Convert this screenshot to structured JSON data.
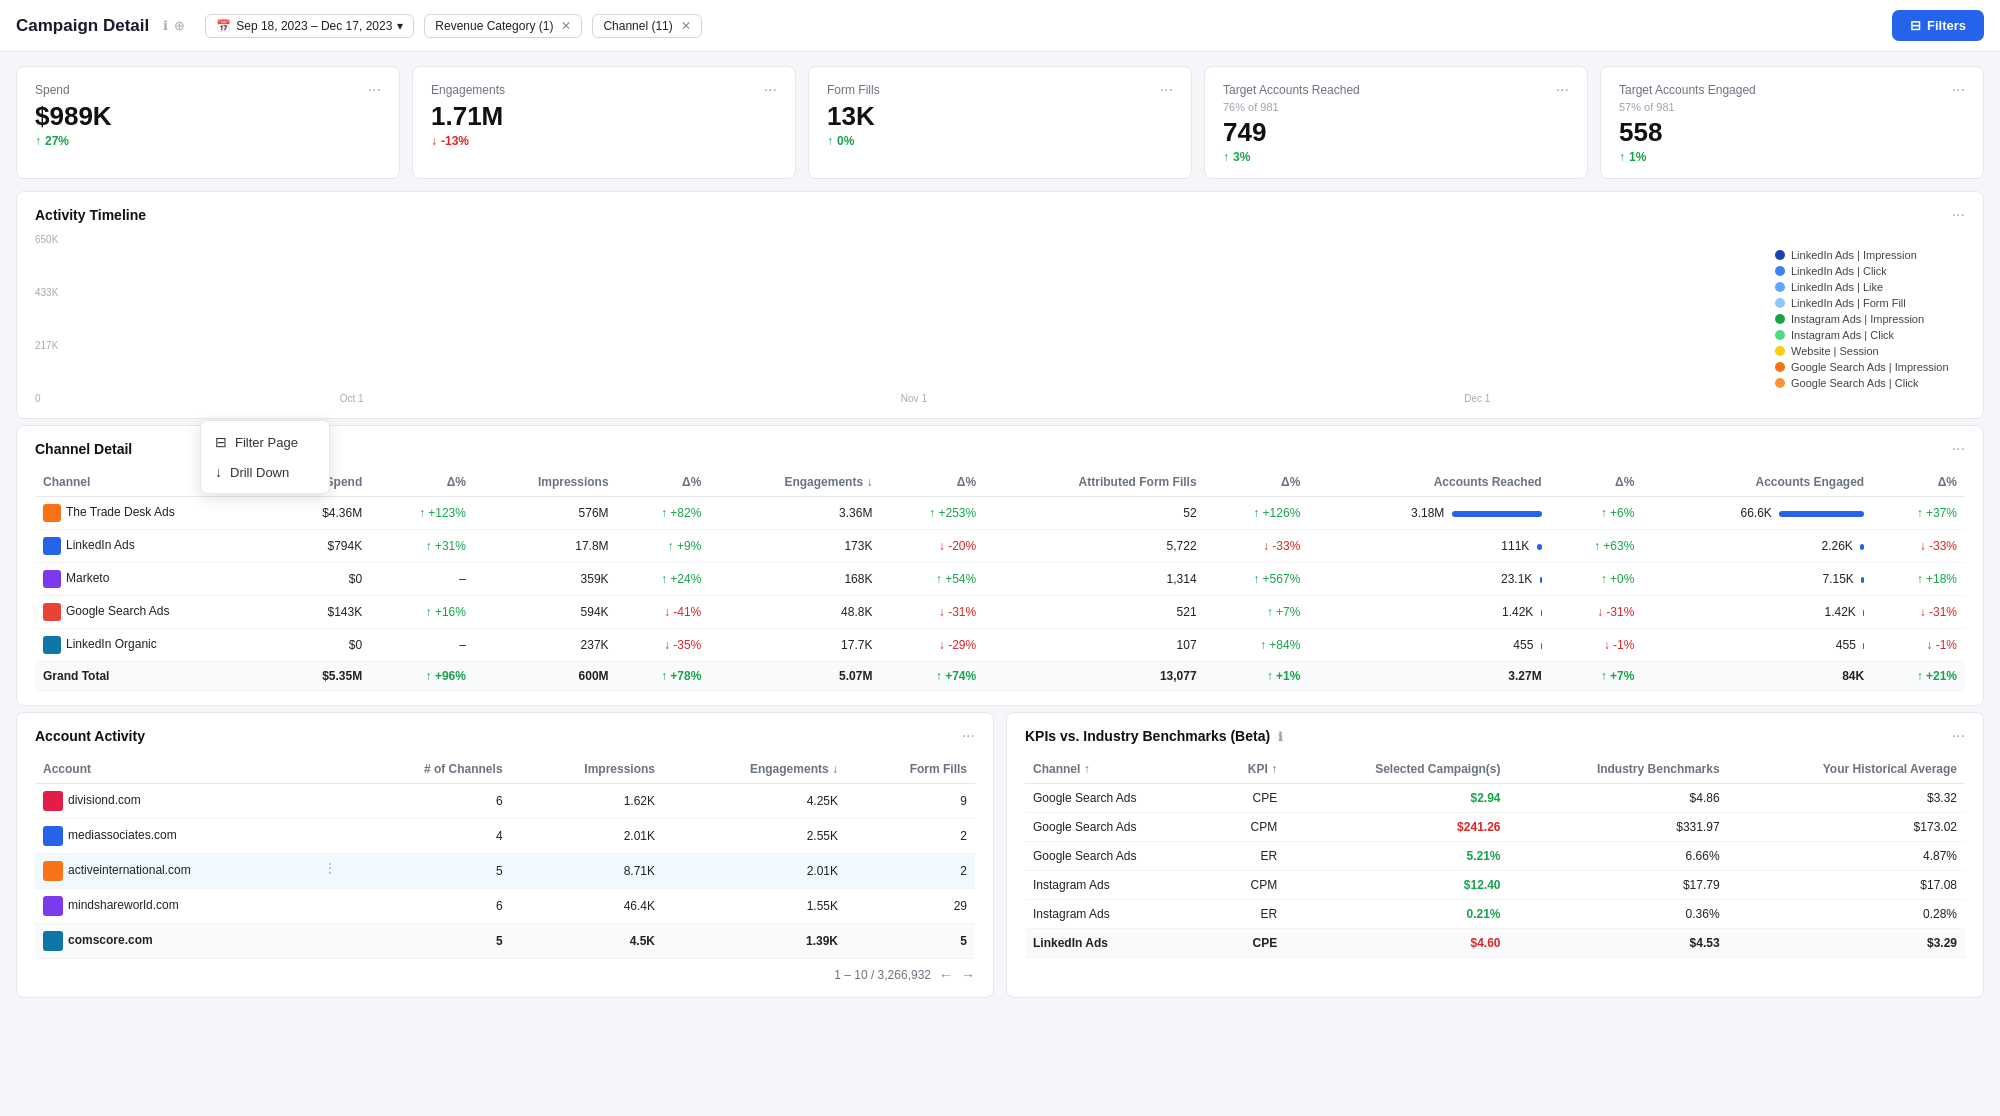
{
  "header": {
    "title": "Campaign Detail",
    "date_range": "Sep 18, 2023 – Dec 17, 2023",
    "filters": [
      {
        "label": "Revenue Category",
        "count": "(1)",
        "id": "revenue"
      },
      {
        "label": "Channel",
        "count": "(11)",
        "id": "channel"
      }
    ],
    "filters_button": "Filters"
  },
  "kpi_cards": [
    {
      "label": "Spend",
      "value": "$989K",
      "delta": "27%",
      "delta_dir": "up"
    },
    {
      "label": "Engagements",
      "value": "1.71M",
      "delta": "-13%",
      "delta_dir": "down"
    },
    {
      "label": "Form Fills",
      "value": "13K",
      "delta": "0%",
      "delta_dir": "up"
    },
    {
      "label": "Target Accounts Reached",
      "sub": "76% of 981",
      "value": "749",
      "delta": "3%",
      "delta_dir": "up"
    },
    {
      "label": "Target Accounts Engaged",
      "sub": "57% of 981",
      "value": "558",
      "delta": "1%",
      "delta_dir": "up"
    }
  ],
  "timeline": {
    "title": "Activity Timeline",
    "y_labels": [
      "650K",
      "433K",
      "217K",
      "0"
    ],
    "x_labels": [
      "Oct 1",
      "Nov 1",
      "Dec 1"
    ],
    "legend": [
      {
        "label": "LinkedIn Ads | Impression",
        "color": "#1e40af"
      },
      {
        "label": "LinkedIn Ads | Click",
        "color": "#3b82f6"
      },
      {
        "label": "LinkedIn Ads | Like",
        "color": "#60a5fa"
      },
      {
        "label": "LinkedIn Ads | Form Fill",
        "color": "#93c5fd"
      },
      {
        "label": "Instagram Ads | Impression",
        "color": "#16a34a"
      },
      {
        "label": "Instagram Ads | Click",
        "color": "#4ade80"
      },
      {
        "label": "Website | Session",
        "color": "#facc15"
      },
      {
        "label": "Google Search Ads | Impression",
        "color": "#f97316"
      },
      {
        "label": "Google Search Ads | Click",
        "color": "#fb923c"
      }
    ]
  },
  "channel_detail": {
    "title": "Channel Detail",
    "columns": [
      "Channel",
      "Spend",
      "Δ%",
      "Impressions",
      "Δ%",
      "Engagements ↓",
      "Δ%",
      "Attributed Form Fills",
      "Δ%",
      "Accounts Reached",
      "Δ%",
      "Accounts Engaged",
      "Δ%"
    ],
    "rows": [
      {
        "channel": "The Trade Desk Ads",
        "color": "#f97316",
        "spend": "$4.36M",
        "spend_delta": "+123%",
        "spend_delta_dir": "up",
        "impressions": "576M",
        "imp_delta": "+82%",
        "imp_delta_dir": "up",
        "engagements": "3.36M",
        "eng_delta": "+253%",
        "eng_delta_dir": "up",
        "form_fills": "52",
        "ff_delta": "+126%",
        "ff_delta_dir": "up",
        "accounts_reached": "3.18M",
        "ar_delta": "+6%",
        "ar_delta_dir": "up",
        "ar_bar": 90,
        "accounts_engaged": "66.6K",
        "ae_delta": "+37%",
        "ae_delta_dir": "up",
        "ae_bar": 85
      },
      {
        "channel": "LinkedIn Ads",
        "color": "#2563eb",
        "spend": "$794K",
        "spend_delta": "+31%",
        "spend_delta_dir": "up",
        "impressions": "17.8M",
        "imp_delta": "+9%",
        "imp_delta_dir": "up",
        "engagements": "173K",
        "eng_delta": "-20%",
        "eng_delta_dir": "down",
        "form_fills": "5,722",
        "ff_delta": "-33%",
        "ff_delta_dir": "down",
        "accounts_reached": "111K",
        "ar_delta": "+63%",
        "ar_delta_dir": "up",
        "ar_bar": 5,
        "accounts_engaged": "2.26K",
        "ae_delta": "-33%",
        "ae_delta_dir": "down",
        "ae_bar": 4
      },
      {
        "channel": "Marketo",
        "color": "#7c3aed",
        "spend": "$0",
        "spend_delta": "–",
        "spend_delta_dir": "neutral",
        "impressions": "359K",
        "imp_delta": "+24%",
        "imp_delta_dir": "up",
        "engagements": "168K",
        "eng_delta": "+54%",
        "eng_delta_dir": "up",
        "form_fills": "1,314",
        "ff_delta": "+567%",
        "ff_delta_dir": "up",
        "accounts_reached": "23.1K",
        "ar_delta": "+0%",
        "ar_delta_dir": "up",
        "ar_bar": 2,
        "accounts_engaged": "7.15K",
        "ae_delta": "+18%",
        "ae_delta_dir": "up",
        "ae_bar": 3
      },
      {
        "channel": "Google Search Ads",
        "color": "#ea4335",
        "spend": "$143K",
        "spend_delta": "+16%",
        "spend_delta_dir": "up",
        "impressions": "594K",
        "imp_delta": "-41%",
        "imp_delta_dir": "down",
        "engagements": "48.8K",
        "eng_delta": "-31%",
        "eng_delta_dir": "down",
        "form_fills": "521",
        "ff_delta": "+7%",
        "ff_delta_dir": "up",
        "accounts_reached": "1.42K",
        "ar_delta": "-31%",
        "ar_delta_dir": "down",
        "ar_bar": 1,
        "accounts_engaged": "1.42K",
        "ae_delta": "-31%",
        "ae_delta_dir": "down",
        "ae_bar": 1
      },
      {
        "channel": "LinkedIn Organic",
        "color": "#0e76a8",
        "spend": "$0",
        "spend_delta": "–",
        "spend_delta_dir": "neutral",
        "impressions": "237K",
        "imp_delta": "-35%",
        "imp_delta_dir": "down",
        "engagements": "17.7K",
        "eng_delta": "-29%",
        "eng_delta_dir": "down",
        "form_fills": "107",
        "ff_delta": "+84%",
        "ff_delta_dir": "up",
        "accounts_reached": "455",
        "ar_delta": "-1%",
        "ar_delta_dir": "down",
        "ar_bar": 1,
        "accounts_engaged": "455",
        "ae_delta": "-1%",
        "ae_delta_dir": "down",
        "ae_bar": 1
      }
    ],
    "total_row": {
      "label": "Grand Total",
      "spend": "$5.35M",
      "spend_delta": "+96%",
      "impressions": "600M",
      "imp_delta": "+78%",
      "engagements": "5.07M",
      "eng_delta": "+74%",
      "form_fills": "13,077",
      "ff_delta": "+1%",
      "accounts_reached": "3.27M",
      "ar_delta": "+7%",
      "accounts_engaged": "84K",
      "ae_delta": "+21%"
    }
  },
  "account_activity": {
    "title": "Account Activity",
    "columns": [
      "Account",
      "# of Channels",
      "Impressions",
      "Engagements ↓",
      "Form Fills"
    ],
    "rows": [
      {
        "account": "divisiond.com",
        "channels": 6,
        "impressions": "1.62K",
        "engagements": "4.25K",
        "form_fills": 9
      },
      {
        "account": "mediassociates.com",
        "channels": 4,
        "impressions": "2.01K",
        "engagements": "2.55K",
        "form_fills": 2
      },
      {
        "account": "activeinternational.com",
        "channels": 5,
        "impressions": "8.71K",
        "engagements": "2.01K",
        "form_fills": 2,
        "has_menu": true
      },
      {
        "account": "mindshareworld.com",
        "channels": 6,
        "impressions": "46.4K",
        "engagements": "1.55K",
        "form_fills": 29
      },
      {
        "account": "comscore.com",
        "channels": 5,
        "impressions": "4.5K",
        "engagements": "1.39K",
        "form_fills": 5
      }
    ],
    "pagination": "1 – 10 / 3,266,932",
    "context_menu": {
      "items": [
        "Filter Page",
        "Drill Down"
      ]
    }
  },
  "benchmarks": {
    "title": "KPIs vs. Industry Benchmarks (Beta)",
    "columns": [
      "Channel ↑",
      "KPI ↑",
      "Selected Campaign(s)",
      "Industry Benchmarks",
      "Your Historical Average"
    ],
    "rows": [
      {
        "channel": "Google Search Ads",
        "kpi": "CPE",
        "selected": "$2.94",
        "industry": "$4.86",
        "historical": "$3.32",
        "highlight": "green"
      },
      {
        "channel": "Google Search Ads",
        "kpi": "CPM",
        "selected": "$241.26",
        "industry": "$331.97",
        "historical": "$173.02",
        "highlight": "red"
      },
      {
        "channel": "Google Search Ads",
        "kpi": "ER",
        "selected": "5.21%",
        "industry": "6.66%",
        "historical": "4.87%",
        "highlight": "green"
      },
      {
        "channel": "Instagram Ads",
        "kpi": "CPM",
        "selected": "$12.40",
        "industry": "$17.79",
        "historical": "$17.08",
        "highlight": "green"
      },
      {
        "channel": "Instagram Ads",
        "kpi": "ER",
        "selected": "0.21%",
        "industry": "0.36%",
        "historical": "0.28%",
        "highlight": "green"
      },
      {
        "channel": "LinkedIn Ads",
        "kpi": "CPE",
        "selected": "$4.60",
        "industry": "$4.53",
        "historical": "$3.29",
        "highlight": "red"
      }
    ]
  }
}
